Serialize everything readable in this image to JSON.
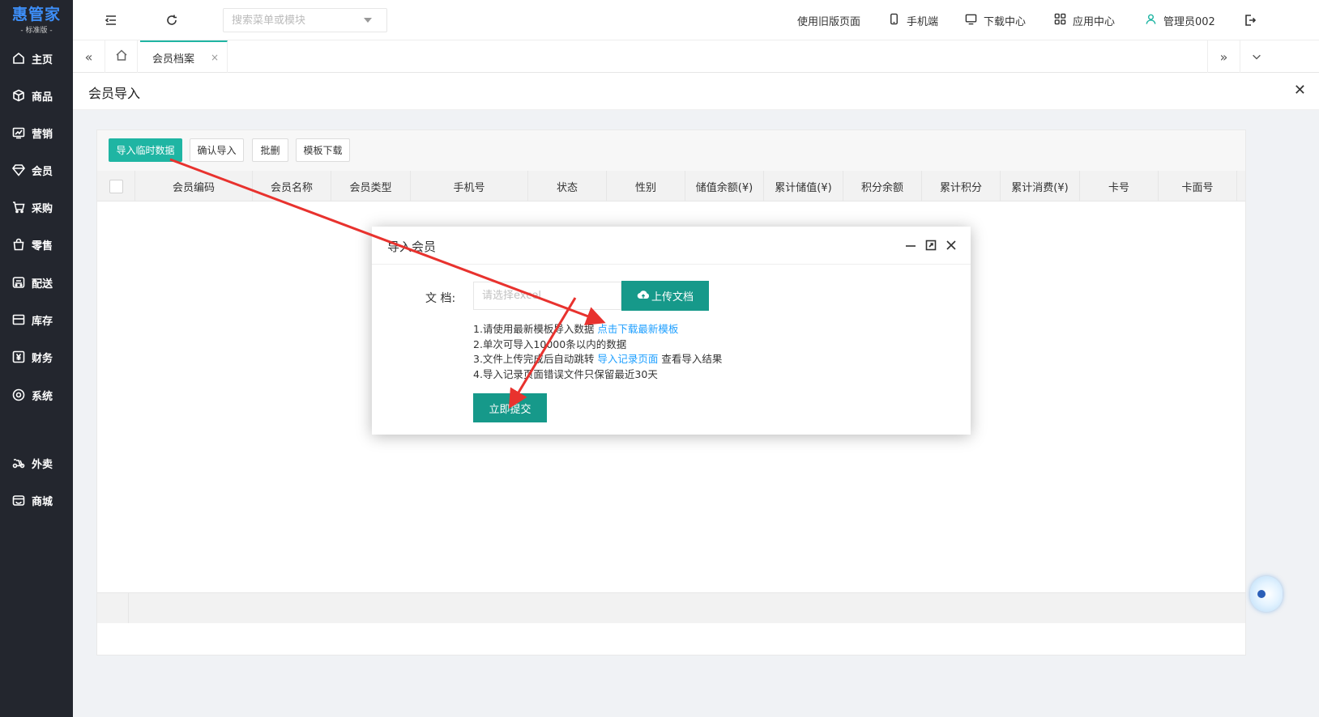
{
  "sidebar": {
    "logo_title": "惠管家",
    "logo_sub": "- 标准版 -",
    "items": [
      {
        "label": "主页",
        "icon": "home-icon"
      },
      {
        "label": "商品",
        "icon": "box-icon"
      },
      {
        "label": "营销",
        "icon": "chart-icon"
      },
      {
        "label": "会员",
        "icon": "diamond-icon"
      },
      {
        "label": "采购",
        "icon": "cart-icon"
      },
      {
        "label": "零售",
        "icon": "bag-icon"
      },
      {
        "label": "配送",
        "icon": "truck-icon"
      },
      {
        "label": "库存",
        "icon": "warehouse-icon"
      },
      {
        "label": "财务",
        "icon": "yen-icon"
      },
      {
        "label": "系统",
        "icon": "settings-icon"
      },
      {
        "label": "外卖",
        "icon": "delivery-icon"
      },
      {
        "label": "商城",
        "icon": "store-icon"
      }
    ]
  },
  "topbar": {
    "search_placeholder": "搜索菜单或模块",
    "links": {
      "old_page": "使用旧版页面",
      "mobile": "手机端",
      "download": "下载中心",
      "apps": "应用中心",
      "user": "管理员002"
    }
  },
  "tabs": {
    "active_label": "会员档案",
    "close_glyph": "×"
  },
  "page": {
    "title": "会员导入"
  },
  "toolbar": {
    "import_temp": "导入临时数据",
    "confirm_import": "确认导入",
    "batch_delete": "批删",
    "template_download": "模板下载"
  },
  "table": {
    "columns": [
      "会员编码",
      "会员名称",
      "会员类型",
      "手机号",
      "状态",
      "性别",
      "储值余额(¥)",
      "累计储值(¥)",
      "积分余额",
      "累计积分",
      "累计消费(¥)",
      "卡号",
      "卡面号"
    ]
  },
  "modal": {
    "title": "导入会员",
    "field_label": "文 档:",
    "file_placeholder": "请选择excel",
    "upload_label": "上传文档",
    "tip1_text": "1.请使用最新模板导入数据",
    "tip1_link": "点击下载最新模板",
    "tip2_text": "2.单次可导入10000条以内的数据",
    "tip3_text": "3.文件上传完成后自动跳转",
    "tip3_link": "导入记录页面",
    "tip3_suffix": "查看导入结果",
    "tip4_text": "4.导入记录页面错误文件只保留最近30天",
    "submit_label": "立即提交"
  },
  "colors": {
    "sidebar_bg": "#23262e",
    "accent": "#1fb5a3",
    "button_dark": "#16998a",
    "link": "#1e9fff",
    "annotation": "#e8322e"
  }
}
